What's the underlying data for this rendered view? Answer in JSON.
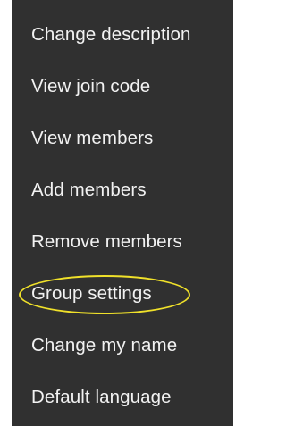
{
  "menu": {
    "items": [
      {
        "label": "Change description"
      },
      {
        "label": "View join code"
      },
      {
        "label": "View members"
      },
      {
        "label": "Add members"
      },
      {
        "label": "Remove members"
      },
      {
        "label": "Group settings",
        "highlighted": true
      },
      {
        "label": "Change my name"
      },
      {
        "label": "Default language"
      }
    ],
    "background_color": "#303030",
    "text_color": "#f2f2f2",
    "highlight_color": "#f0e12a"
  }
}
